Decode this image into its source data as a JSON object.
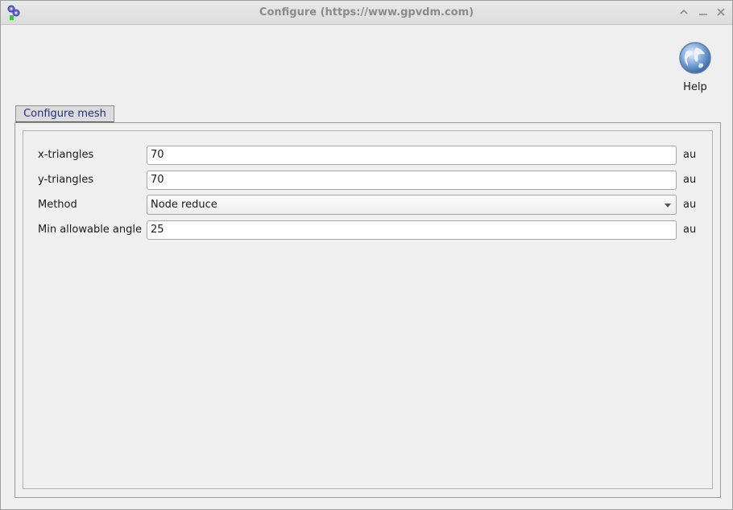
{
  "window": {
    "title": "Configure (https://www.gpvdm.com)"
  },
  "toolbar": {
    "help_label": "Help"
  },
  "tabs": [
    {
      "label": "Configure mesh"
    }
  ],
  "form": {
    "rows": [
      {
        "label": "x-triangles",
        "value": "70",
        "unit": "au",
        "type": "text"
      },
      {
        "label": "y-triangles",
        "value": "70",
        "unit": "au",
        "type": "text"
      },
      {
        "label": "Method",
        "value": "Node reduce",
        "unit": "au",
        "type": "select"
      },
      {
        "label": "Min allowable angle",
        "value": "25",
        "unit": "au",
        "type": "text"
      }
    ]
  },
  "colors": {
    "tab_underline": "#3d4a8a",
    "title_text": "#8a8a8a"
  }
}
